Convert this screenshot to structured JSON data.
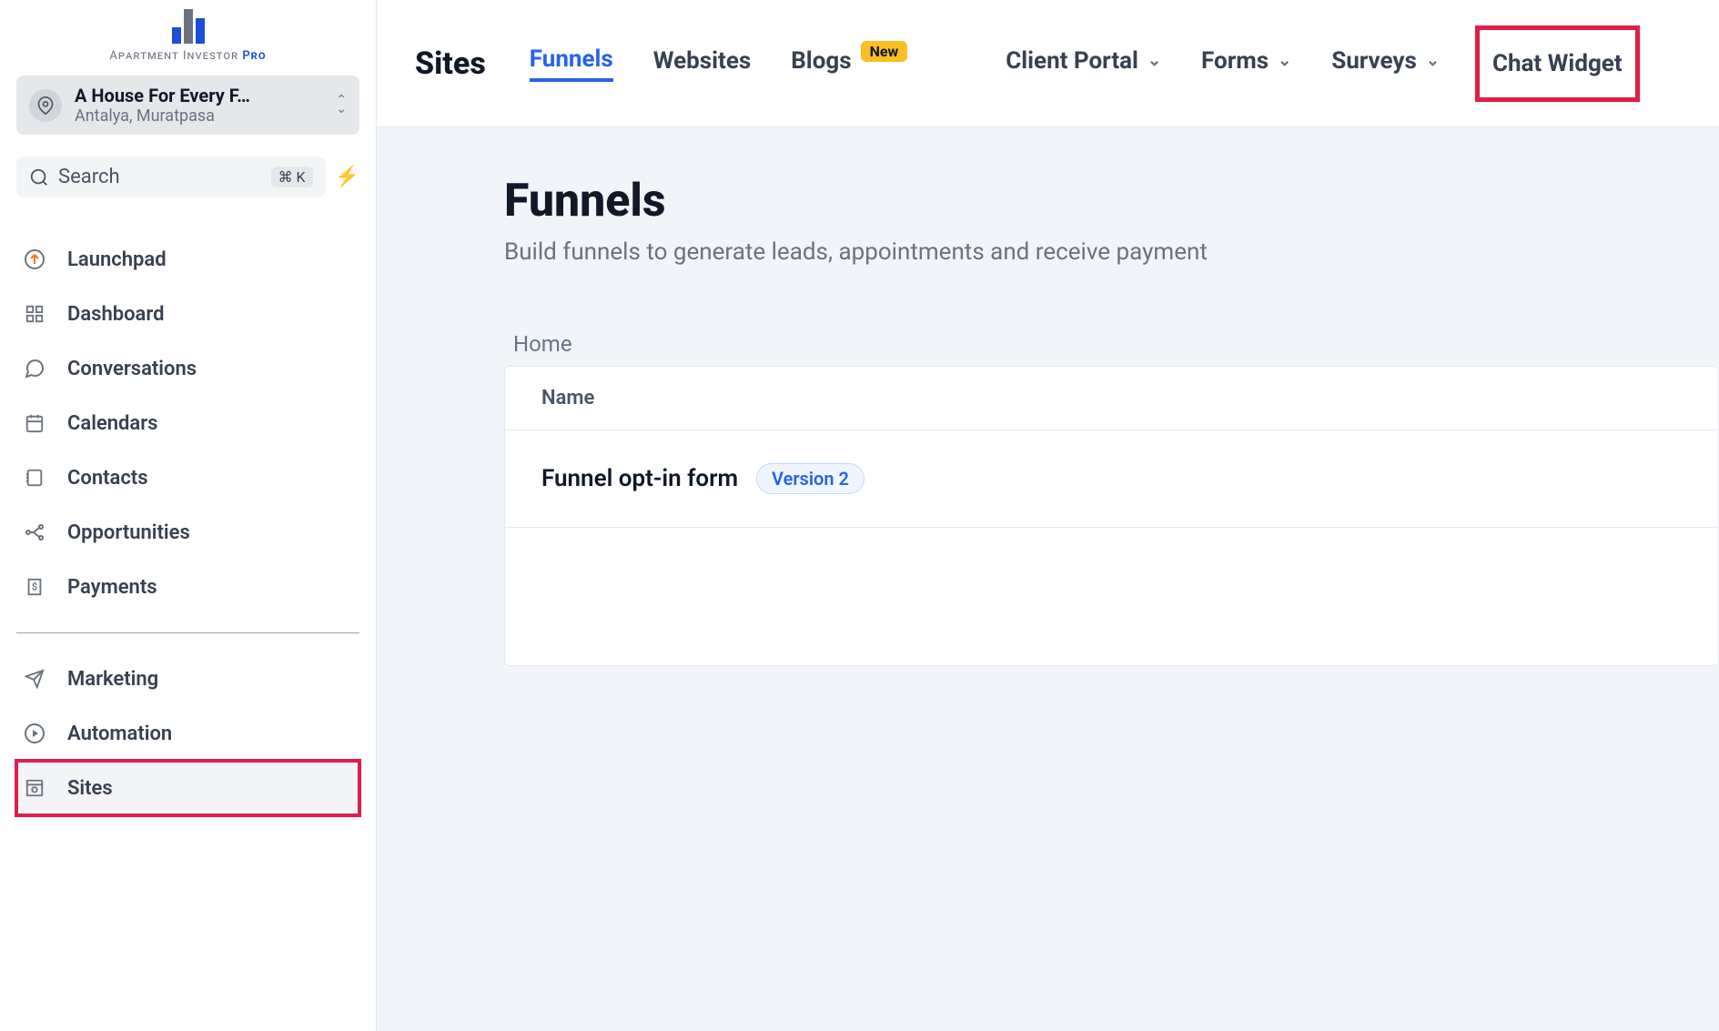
{
  "brand": {
    "name": "Apartment Investor",
    "suffix": "Pro"
  },
  "account": {
    "name": "A House For Every F…",
    "location": "Antalya, Muratpasa"
  },
  "search": {
    "placeholder": "Search",
    "shortcut": "⌘ K"
  },
  "nav": {
    "group1": [
      {
        "label": "Launchpad",
        "icon": "launchpad"
      },
      {
        "label": "Dashboard",
        "icon": "dashboard"
      },
      {
        "label": "Conversations",
        "icon": "chat"
      },
      {
        "label": "Calendars",
        "icon": "calendar"
      },
      {
        "label": "Contacts",
        "icon": "contacts"
      },
      {
        "label": "Opportunities",
        "icon": "opportunities"
      },
      {
        "label": "Payments",
        "icon": "payments"
      }
    ],
    "group2": [
      {
        "label": "Marketing",
        "icon": "send"
      },
      {
        "label": "Automation",
        "icon": "automation"
      },
      {
        "label": "Sites",
        "icon": "sites",
        "highlighted": true
      }
    ]
  },
  "topbar": {
    "title": "Sites",
    "tabs": [
      {
        "label": "Funnels",
        "active": true
      },
      {
        "label": "Websites"
      },
      {
        "label": "Blogs",
        "badge": "New"
      },
      {
        "label": "Client Portal",
        "dropdown": true
      },
      {
        "label": "Forms",
        "dropdown": true
      },
      {
        "label": "Surveys",
        "dropdown": true
      },
      {
        "label": "Chat Widget",
        "highlighted": true
      }
    ]
  },
  "page": {
    "title": "Funnels",
    "subtitle": "Build funnels to generate leads, appointments and receive payment",
    "breadcrumb": "Home",
    "table": {
      "columns": {
        "name": "Name"
      },
      "rows": [
        {
          "name": "Funnel opt-in form",
          "badge": "Version 2"
        }
      ]
    }
  }
}
